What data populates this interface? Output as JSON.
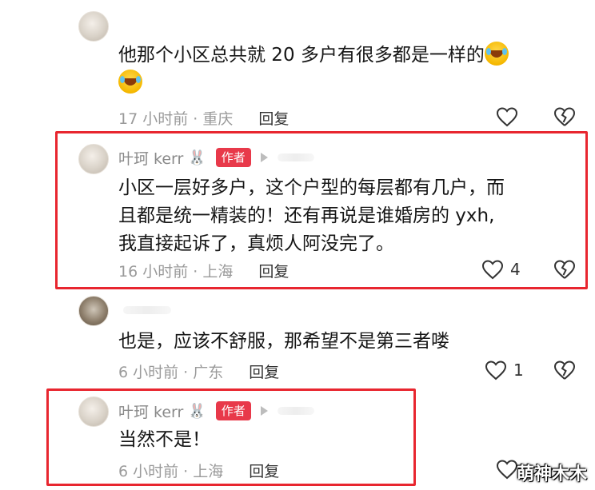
{
  "comments": [
    {
      "name": "",
      "text": "他那个小区总共就 20 多户有很多都是一样的",
      "time_location": "17 小时前 · 重庆",
      "reply_label": "回复",
      "likes": ""
    },
    {
      "name": "叶珂 kerr",
      "badge": "作者",
      "text_lines": [
        "小区一层好多户，这个户型的每层都有几户，而",
        "且都是统一精装的！还有再说是谁婚房的 yxh,",
        "我直接起诉了，真烦人阿没完了。"
      ],
      "time_location": "16 小时前 · 上海",
      "reply_label": "回复",
      "likes": "4"
    },
    {
      "name": "",
      "text": "也是，应该不舒服，那希望不是第三者喽",
      "time_location": "6 小时前 · 广东",
      "reply_label": "回复",
      "likes": "1"
    },
    {
      "name": "叶珂 kerr",
      "badge": "作者",
      "text": "当然不是！",
      "time_location": "6 小时前 · 上海",
      "reply_label": "回复",
      "likes": ""
    }
  ],
  "watermark": "萌神木木",
  "colors": {
    "highlight": "#e8262f",
    "badge": "#e8394a",
    "meta": "#9a9a9a"
  },
  "icons": [
    "avatar",
    "laughing-crying-emoji-icon",
    "rabbit-icon",
    "play-icon",
    "heart-icon",
    "broken-heart-icon"
  ]
}
